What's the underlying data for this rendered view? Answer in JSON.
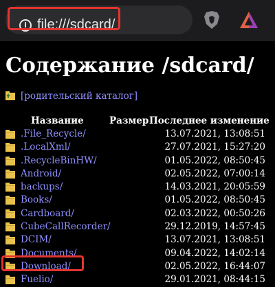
{
  "browser": {
    "url": "file:///sdcard/",
    "icons": {
      "info": "info-icon",
      "brave": "brave-shield-icon",
      "rewards": "brave-rewards-triangle-icon"
    },
    "colors": {
      "highlight": "#e3342f",
      "link": "#8f8fff",
      "shield": "#8a8a8e"
    }
  },
  "page": {
    "title": "Содержание /sdcard/",
    "parent_link": "[родительский каталог]",
    "columns": {
      "name": "Название",
      "size": "Размер",
      "modified": "Последнее изменение"
    },
    "entries": [
      {
        "name": ".File_Recycle/",
        "modified": "13.07.2021, 13:08:51"
      },
      {
        "name": ".LocalXml/",
        "modified": "27.07.2021, 15:27:20"
      },
      {
        "name": ".RecycleBinHW/",
        "modified": "01.05.2022, 08:50:45"
      },
      {
        "name": "Android/",
        "modified": "02.05.2022, 07:00:14"
      },
      {
        "name": "backups/",
        "modified": "14.03.2021, 20:05:59"
      },
      {
        "name": "Books/",
        "modified": "01.05.2022, 08:50:45"
      },
      {
        "name": "Cardboard/",
        "modified": "02.03.2022, 00:50:26"
      },
      {
        "name": "CubeCallRecorder/",
        "modified": "29.12.2019, 14:57:45"
      },
      {
        "name": "DCIM/",
        "modified": "13.07.2021, 13:08:51"
      },
      {
        "name": "Documents/",
        "modified": "09.04.2022, 14:02:14"
      },
      {
        "name": "Download/",
        "modified": "02.05.2022, 16:44:07",
        "highlighted": true
      },
      {
        "name": "Fuelio/",
        "modified": "29.01.2021, 08:44:15"
      }
    ]
  }
}
